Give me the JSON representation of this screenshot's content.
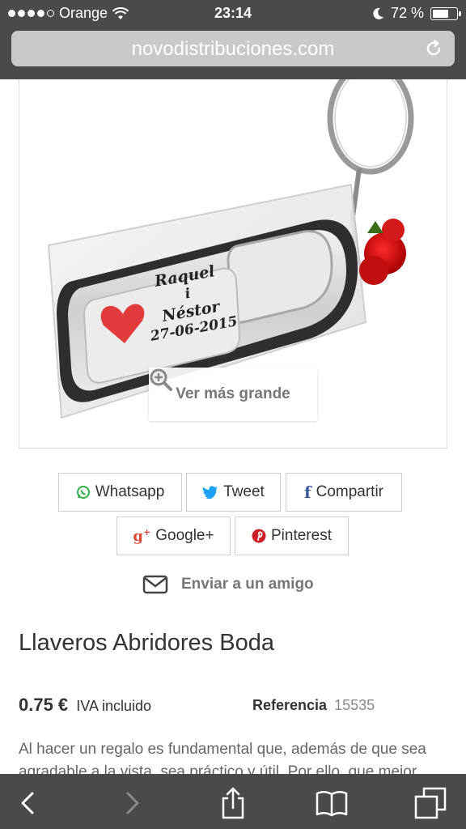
{
  "status_bar": {
    "carrier": "Orange",
    "time": "23:14",
    "battery_percent": "72 %",
    "battery_level": 0.72
  },
  "browser": {
    "url": "novodistribuciones.com"
  },
  "product_image": {
    "engraving_line1": "Raquel",
    "engraving_line2": "i",
    "engraving_line3": "Néstor",
    "engraving_line4": "27-06-2015",
    "zoom_label": "Ver más grande"
  },
  "share": {
    "whatsapp": "Whatsapp",
    "tweet": "Tweet",
    "facebook": "Compartir",
    "googleplus": "Google+",
    "pinterest": "Pinterest",
    "send_friend": "Enviar a un amigo",
    "colors": {
      "whatsapp": "#2fb043",
      "twitter": "#1da1f2",
      "facebook": "#3b5998",
      "googleplus": "#dd4b39",
      "pinterest": "#cb2027"
    }
  },
  "product": {
    "title": "Llaveros Abridores Boda",
    "price": "0.75 €",
    "tax_note": "IVA incluido",
    "reference_label": "Referencia",
    "reference_value": "15535",
    "description": "Al hacer un regalo es fundamental que, además de que sea agradable a la vista, sea práctico y útil. Por ello, que mejor"
  },
  "toolbar": {
    "icons": [
      "back-icon",
      "forward-icon",
      "share-icon",
      "bookmarks-icon",
      "tabs-icon"
    ]
  }
}
